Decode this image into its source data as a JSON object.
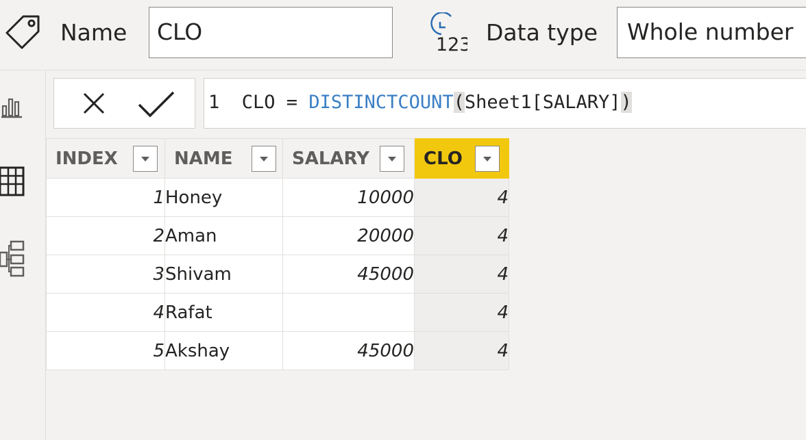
{
  "properties": {
    "name_label": "Name",
    "name_value": "CLO",
    "datatype_label": "Data type",
    "datatype_value": "Whole number"
  },
  "formula": {
    "line_number": "1",
    "prefix": "CLO = ",
    "function": "DISTINCTCOUNT",
    "open_paren": "(",
    "argument": "Sheet1[SALARY]",
    "close_paren": ")"
  },
  "icons": {
    "tag": "tag-icon",
    "datatype": "clock-123-icon",
    "cancel": "close-icon",
    "commit": "checkmark-icon",
    "report_view": "bar-chart-icon",
    "data_view": "table-icon",
    "model_view": "model-icon"
  },
  "colors": {
    "active_column_header": "#f2c80f",
    "keyword": "#3a7fc4"
  },
  "table": {
    "columns": [
      "INDEX",
      "NAME",
      "SALARY",
      "CLO"
    ],
    "rows": [
      {
        "index": "1",
        "name": "Honey",
        "salary": "10000",
        "clo": "4"
      },
      {
        "index": "2",
        "name": "Aman",
        "salary": "20000",
        "clo": "4"
      },
      {
        "index": "3",
        "name": "Shivam",
        "salary": "45000",
        "clo": "4"
      },
      {
        "index": "4",
        "name": "Rafat",
        "salary": "",
        "clo": "4"
      },
      {
        "index": "5",
        "name": "Akshay",
        "salary": "45000",
        "clo": "4"
      }
    ]
  }
}
